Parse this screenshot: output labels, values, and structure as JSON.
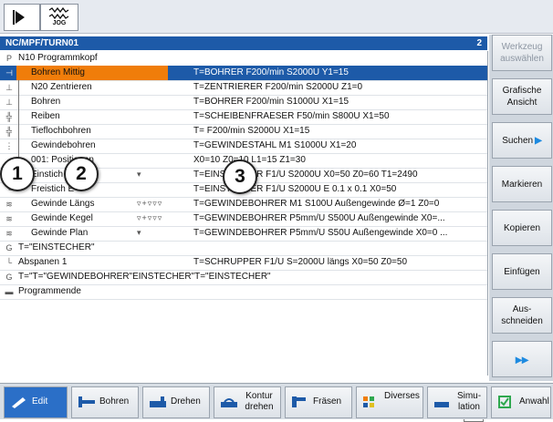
{
  "header": {
    "mode_label": "JOG",
    "path": "NC/MPF/TURN01",
    "count": "2"
  },
  "rows": [
    {
      "icon": "P",
      "name": "N10 Programmkopf",
      "mark": "",
      "param": ""
    },
    {
      "icon": "drill",
      "name": "Bohren Mittig",
      "mark": "",
      "param": "T=BOHRER F200/min S2000U Y1=15"
    },
    {
      "icon": "center",
      "name": "N20 Zentrieren",
      "mark": "",
      "param": "T=ZENTRIERER F200/min S2000U Z1=0"
    },
    {
      "icon": "drill",
      "name": "Bohren",
      "mark": "",
      "param": "T=BOHRER F200/min S1000U X1=15"
    },
    {
      "icon": "ream",
      "name": "Reiben",
      "mark": "",
      "param": "T=SCHEIBENFRAESER F50/min S800U X1=50"
    },
    {
      "icon": "deep",
      "name": "Tieflochbohren",
      "mark": "",
      "param": "T= F200/min S2000U X1=15"
    },
    {
      "icon": "thread",
      "name": "Gewindebohren",
      "mark": "",
      "param": "T=GEWINDESTAHL M1 S1000U X1=20"
    },
    {
      "icon": "pos",
      "name": "001: Positionen",
      "mark": "",
      "param": "X0=10 Z0=10 L1=15 Z1=30"
    },
    {
      "icon": "groove",
      "name": "Einstich",
      "mark": "▾",
      "param": "T=EINSTECHER F1/U S2000U X0=50 Z0=60 T1=2490"
    },
    {
      "icon": "groove",
      "name": "Freistich E",
      "mark": "",
      "param": "T=EINSTECHER F1/U S2000U E 0.1 x 0.1 X0=50"
    },
    {
      "icon": "threadcut",
      "name": "Gewinde Längs",
      "mark": "▿+▿▿▿",
      "param": "T=GEWINDEBOHRER M1 S100U Außengewinde Ø=1 Z0=0"
    },
    {
      "icon": "threadcut",
      "name": "Gewinde Kegel",
      "mark": "▿+▿▿▿",
      "param": "T=GEWINDEBOHRER P5mm/U S500U Außengewinde X0=..."
    },
    {
      "icon": "threadcut",
      "name": "Gewinde Plan",
      "mark": "▾",
      "param": "T=GEWINDEBOHRER P5mm/U S50U Außengewinde X0=0 ..."
    },
    {
      "icon": "G",
      "name": "T=\"EINSTECHER\"",
      "mark": "",
      "param": ""
    },
    {
      "icon": "stock",
      "name": "Abspanen 1",
      "mark": "",
      "param": "T=SCHRUPPER F1/U S=2000U längs X0=50 Z0=50"
    },
    {
      "icon": "G",
      "name": "T=\"T=\"GEWINDEBOHRER\"EINSTECHER\"T=\"EINSTECHER\"",
      "mark": "",
      "param": ""
    },
    {
      "icon": "end",
      "name": "Programmende",
      "mark": "",
      "param": ""
    }
  ],
  "callouts": [
    "1",
    "2",
    "3"
  ],
  "scroll_indicator": ">",
  "softkeys": {
    "werkzeug": "Werkzeug auswählen",
    "grafische": "Grafische Ansicht",
    "suchen": "Suchen",
    "markieren": "Markieren",
    "kopieren": "Kopieren",
    "einfuegen": "Einfügen",
    "ausschneiden": "Aus-schneiden",
    "more": "▸▸"
  },
  "bottom": {
    "edit": "Edit",
    "bohren": "Bohren",
    "drehen": "Drehen",
    "kontur": "Kontur drehen",
    "fraesen": "Fräsen",
    "diverses": "Diverses",
    "simulation": "Simu-lation",
    "anwahl": "Anwahl"
  },
  "colors": {
    "header_blue": "#1d5aa8",
    "selection_orange": "#f07d0a",
    "softkey_arrow": "#1d8ae0"
  }
}
